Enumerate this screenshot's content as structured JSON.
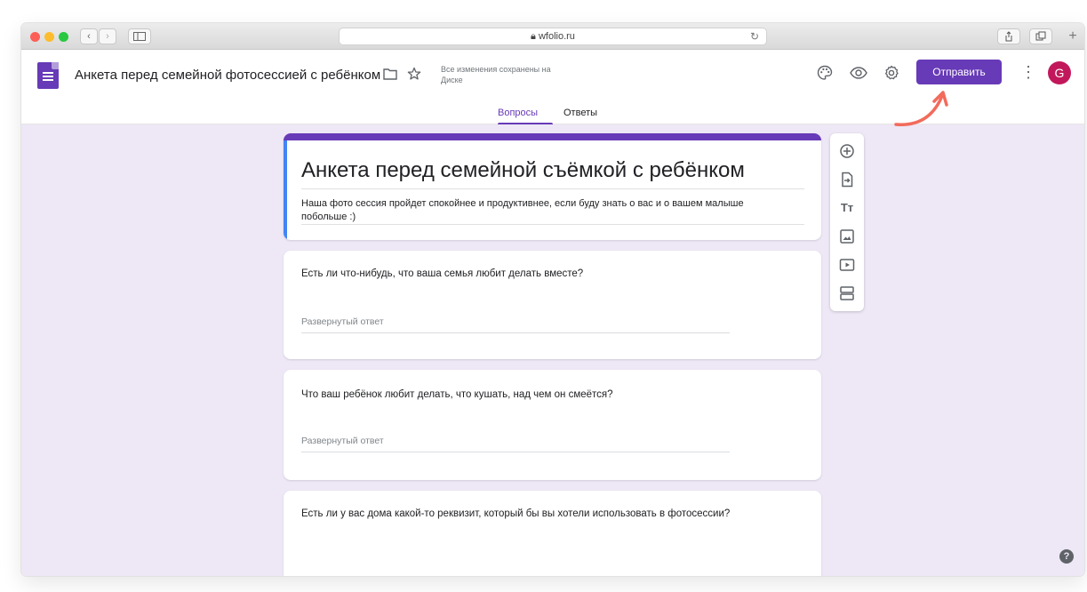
{
  "browser": {
    "url": "wfolio.ru",
    "back_label": "‹",
    "forward_label": "›"
  },
  "header": {
    "doc_title": "Анкета перед семейной фотосессией с ребёнком",
    "saved_status": "Все изменения сохранены на Диске",
    "send_label": "Отправить",
    "more_label": "⋮",
    "avatar_letter": "G"
  },
  "tabs": [
    {
      "label": "Вопросы",
      "active": true
    },
    {
      "label": "Ответы",
      "active": false
    }
  ],
  "form": {
    "title": "Анкета перед семейной съёмкой с ребёнком",
    "description": "Наша фото сессия пройдет спокойнее и продуктивнее, если буду знать о вас и о вашем малыше побольше :)"
  },
  "questions": [
    {
      "text": "Есть ли что-нибудь, что ваша семья любит делать вместе?",
      "placeholder": "Развернутый ответ"
    },
    {
      "text": "Что ваш ребёнок любит делать, что кушать, над чем он смеётся?",
      "placeholder": "Развернутый ответ"
    },
    {
      "text": "Есть ли у вас дома какой-то реквизит, который бы вы хотели использовать в фотосессии?",
      "placeholder": ""
    }
  ],
  "side_toolbar": {
    "title_icon_text": "Tт"
  },
  "help_label": "?",
  "colors": {
    "accent": "#673ab7",
    "background": "#ede7f6",
    "avatar": "#c2185b",
    "annotation_arrow": "#f26b5b"
  },
  "icons": [
    "palette-icon",
    "preview-eye-icon",
    "settings-gear-icon",
    "folder-icon",
    "star-icon",
    "add-question-icon",
    "import-questions-icon",
    "add-title-icon",
    "add-image-icon",
    "add-video-icon",
    "add-section-icon"
  ]
}
